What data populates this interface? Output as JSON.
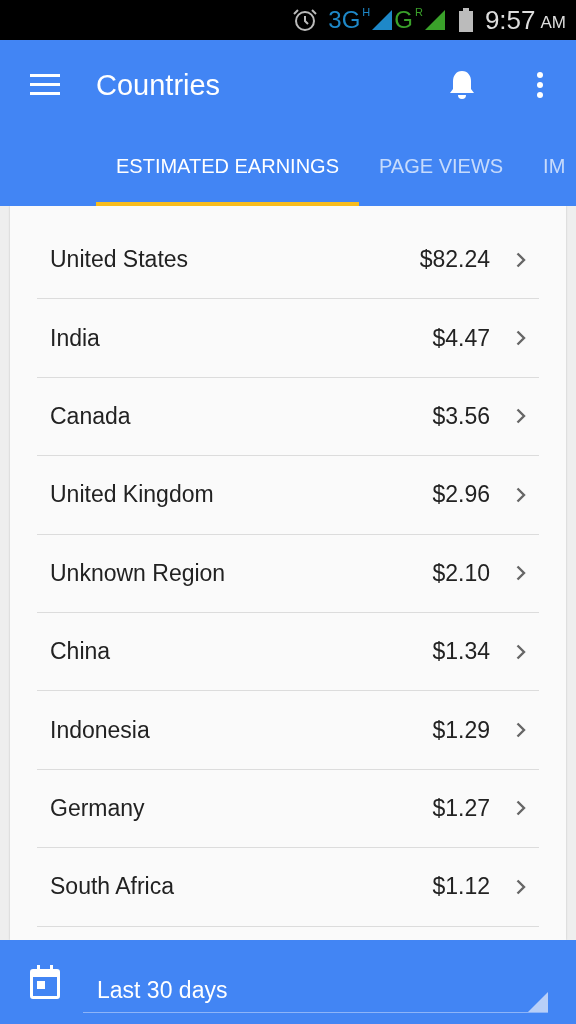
{
  "status_bar": {
    "network_1": "3G",
    "network_1_badge": "H",
    "network_2": "G",
    "network_2_badge": "R",
    "time": "9:57",
    "ampm": "AM"
  },
  "app_bar": {
    "title": "Countries"
  },
  "tabs": [
    {
      "label": "ESTIMATED EARNINGS",
      "selected": true
    },
    {
      "label": "PAGE VIEWS",
      "selected": false
    },
    {
      "label": "IM",
      "selected": false
    }
  ],
  "rows": [
    {
      "country": "United States",
      "amount": "$82.24"
    },
    {
      "country": "India",
      "amount": "$4.47"
    },
    {
      "country": "Canada",
      "amount": "$3.56"
    },
    {
      "country": "United Kingdom",
      "amount": "$2.96"
    },
    {
      "country": "Unknown Region",
      "amount": "$2.10"
    },
    {
      "country": "China",
      "amount": "$1.34"
    },
    {
      "country": "Indonesia",
      "amount": "$1.29"
    },
    {
      "country": "Germany",
      "amount": "$1.27"
    },
    {
      "country": "South Africa",
      "amount": "$1.12"
    }
  ],
  "date_range": {
    "value": "Last 30 days"
  }
}
